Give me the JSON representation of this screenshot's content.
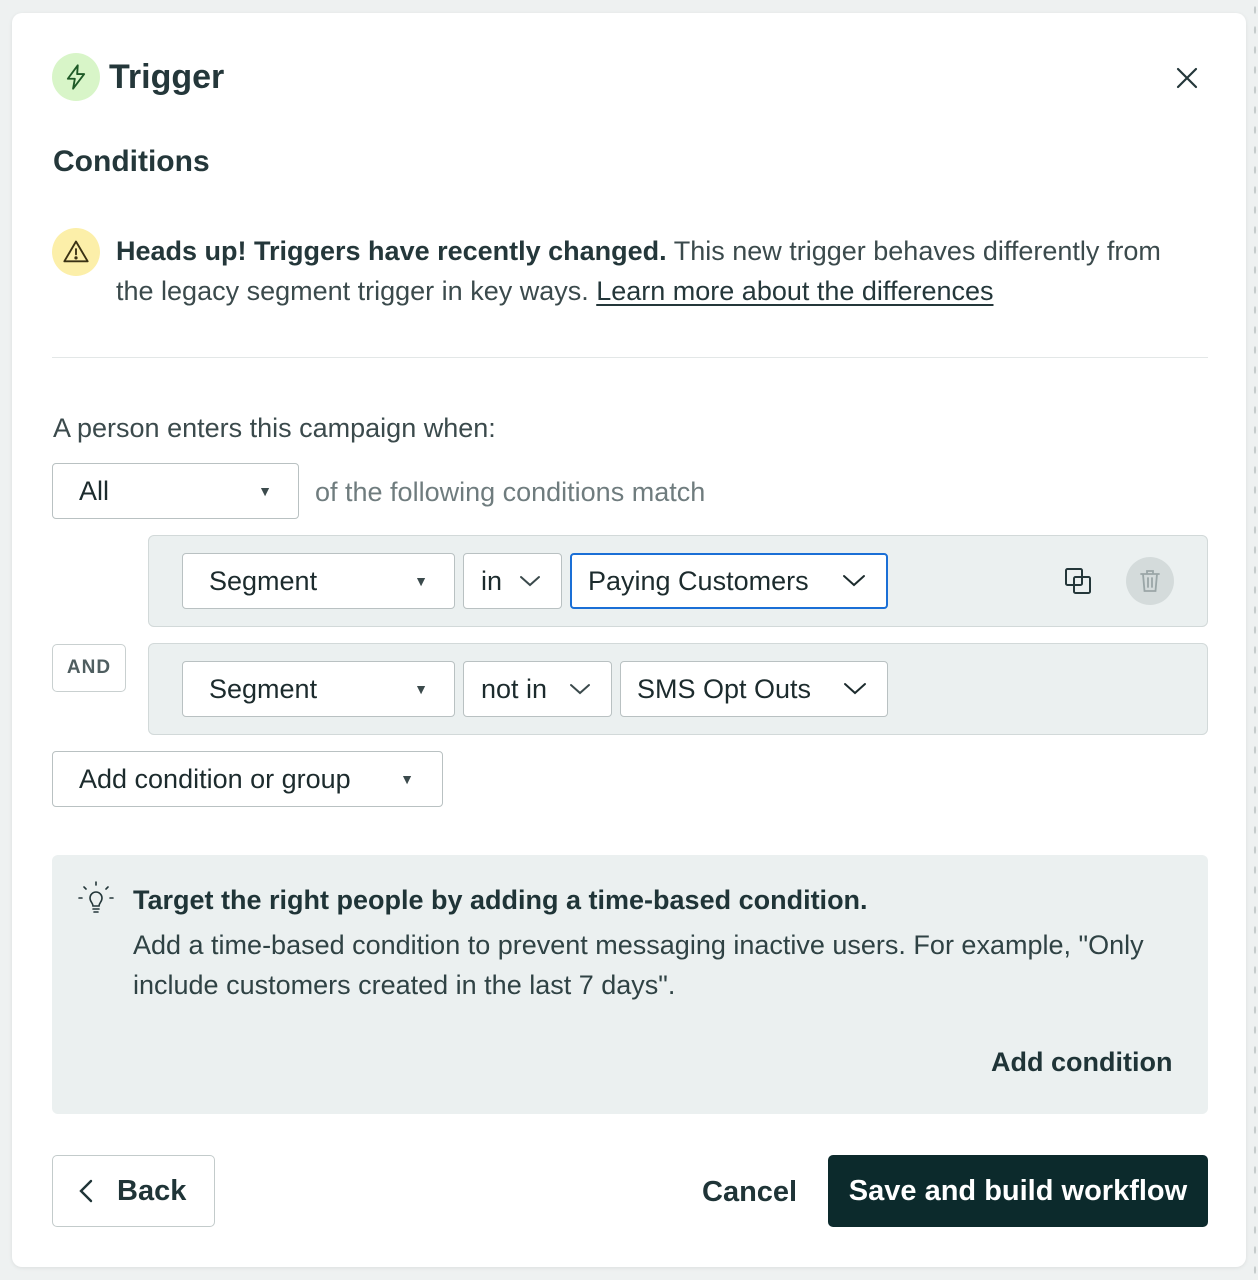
{
  "modal": {
    "title": "Trigger",
    "section_title": "Conditions"
  },
  "notice": {
    "bold": "Heads up! Triggers have recently changed.",
    "text": " This new trigger behaves differently from the legacy segment trigger in key ways. ",
    "link": "Learn more about the differences"
  },
  "conditions": {
    "intro": "A person enters this campaign when:",
    "match_mode": "All",
    "match_suffix": "of the following conditions match",
    "joiner": "AND",
    "rows": [
      {
        "field": "Segment",
        "operator": "in",
        "value": "Paying Customers"
      },
      {
        "field": "Segment",
        "operator": "not in",
        "value": "SMS Opt Outs"
      }
    ],
    "add_label": "Add condition or group"
  },
  "tip": {
    "title": "Target the right people by adding a time-based condition.",
    "body": "Add a time-based condition to prevent messaging inactive users. For example, \"Only include customers created in the last 7 days\".",
    "action": "Add condition"
  },
  "footer": {
    "back": "Back",
    "cancel": "Cancel",
    "save": "Save and build workflow"
  },
  "icons": {
    "trigger": "lightning-icon",
    "close": "close-icon",
    "warning": "warning-icon",
    "copy": "duplicate-icon",
    "delete": "trash-icon",
    "tip": "lightbulb-icon",
    "back": "chevron-left-icon"
  },
  "colors": {
    "primary": "#0c2a2c",
    "focus": "#1a6fd6",
    "trigger_bg": "#d8f5c8",
    "warning_bg": "#fcefa9",
    "panel_bg": "#ebf0f0"
  }
}
